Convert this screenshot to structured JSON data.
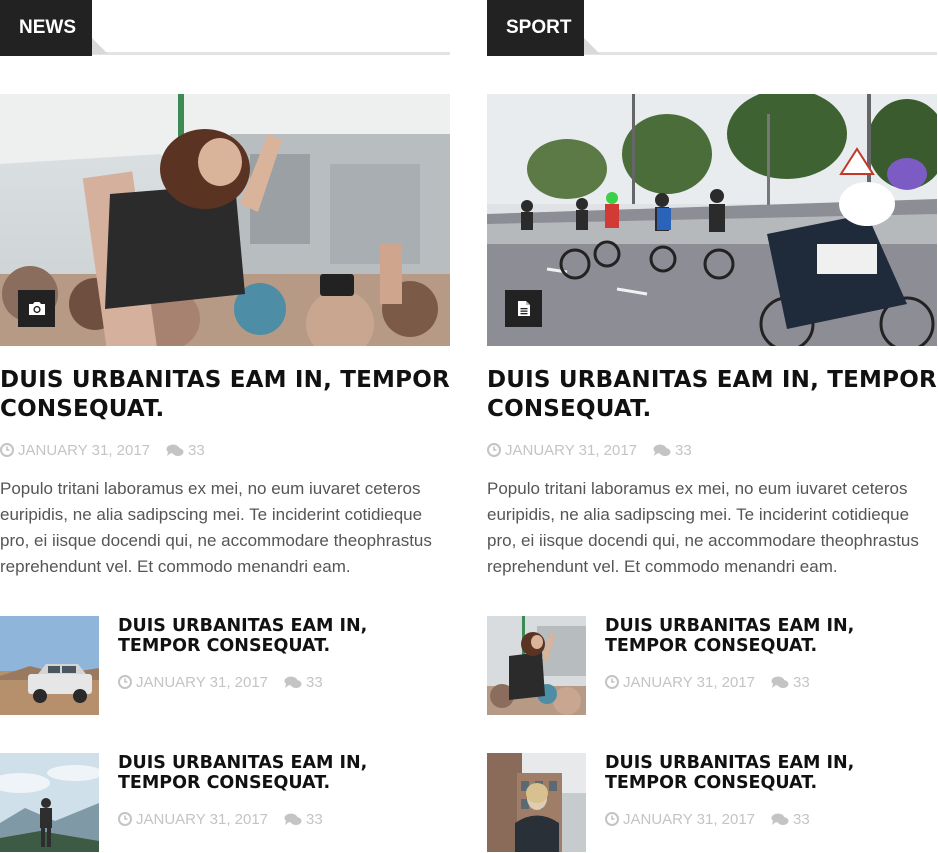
{
  "sections": [
    {
      "label": "NEWS",
      "featured": {
        "title": "DUIS URBANITAS EAM IN, TEMPOR CONSEQUAT.",
        "date": "JANUARY 31, 2017",
        "comments": "33",
        "excerpt": "Populo tritani laboramus ex mei, no eum iuvaret ceteros euripidis, ne alia sadipscing mei. Te inciderint cotidieque pro, ei iisque docendi qui, ne accommodare theophrastus reprehendunt vel. Et commodo menandri eam.",
        "badge_icon": "camera-icon",
        "image": "concert-crowd-photo"
      },
      "items": [
        {
          "title": "DUIS URBANITAS EAM IN, TEMPOR CONSEQUAT.",
          "date": "JANUARY 31, 2017",
          "comments": "33",
          "image": "suv-desert-photo"
        },
        {
          "title": "DUIS URBANITAS EAM IN, TEMPOR CONSEQUAT.",
          "date": "JANUARY 31, 2017",
          "comments": "33",
          "image": "hiker-mountain-photo"
        }
      ]
    },
    {
      "label": "SPORT",
      "featured": {
        "title": "DUIS URBANITAS EAM IN, TEMPOR CONSEQUAT.",
        "date": "JANUARY 31, 2017",
        "comments": "33",
        "excerpt": "Populo tritani laboramus ex mei, no eum iuvaret ceteros euripidis, ne alia sadipscing mei. Te inciderint cotidieque pro, ei iisque docendi qui, ne accommodare theophrastus reprehendunt vel. Et commodo menandri eam.",
        "badge_icon": "document-icon",
        "image": "cycling-race-photo"
      },
      "items": [
        {
          "title": "DUIS URBANITAS EAM IN, TEMPOR CONSEQUAT.",
          "date": "JANUARY 31, 2017",
          "comments": "33",
          "image": "concert-crowd-photo"
        },
        {
          "title": "DUIS URBANITAS EAM IN, TEMPOR CONSEQUAT.",
          "date": "JANUARY 31, 2017",
          "comments": "33",
          "image": "street-woman-photo"
        }
      ]
    }
  ],
  "colors": {
    "tab_bg": "#222222",
    "tab_text": "#ffffff",
    "title": "#111111",
    "meta": "#c4c4c4",
    "excerpt": "#555555",
    "rule": "#e3e3e3"
  },
  "icons": {
    "date": "clock-icon",
    "comments": "comments-icon"
  }
}
